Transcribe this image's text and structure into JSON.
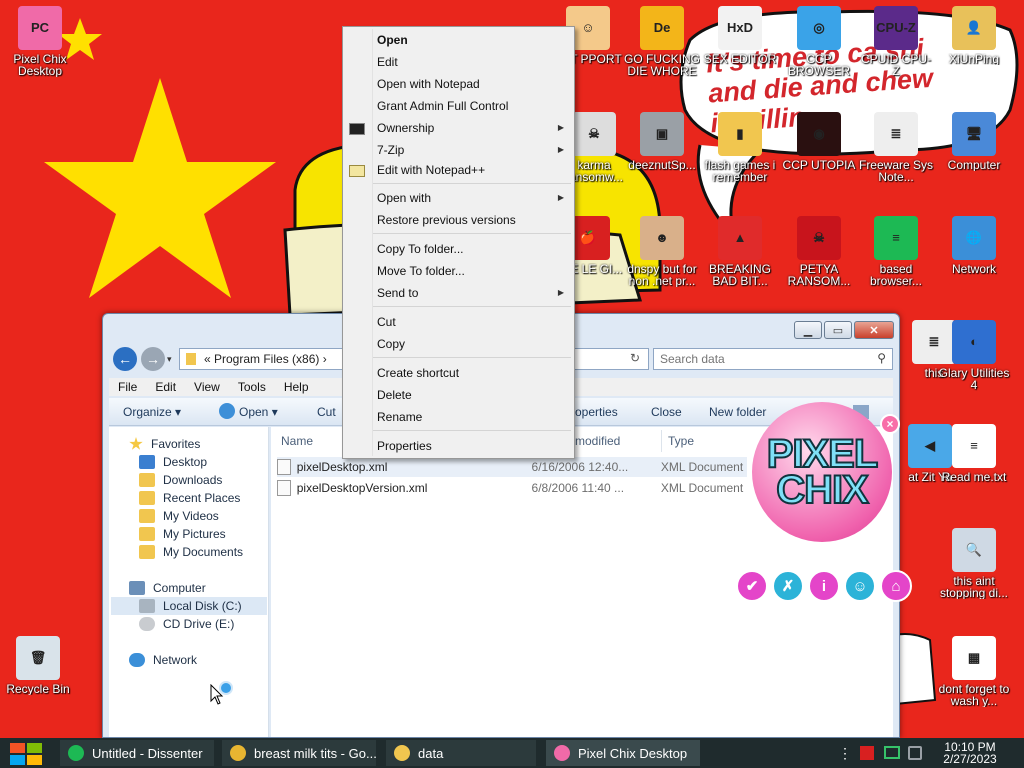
{
  "wallpaper": {
    "bubble_text": "It's time to ca shi\nand die and chew\n  ing illin",
    "colors": {
      "background": "#e9261c",
      "star": "#ffe000"
    }
  },
  "desktop_icons": [
    {
      "id": "pixel-chix",
      "label": "Pixel Chix Desktop",
      "icon": "pixel-chix-logo-icon",
      "color": "#f06aa8",
      "glyph": "PC"
    },
    {
      "id": "recycle-bin",
      "label": "Recycle Bin",
      "icon": "recycle-bin-icon",
      "color": "#d9e3ea",
      "glyph": "🗑"
    },
    {
      "id": "chat-support",
      "label": "HAT PPORT",
      "icon": "support-agent-icon",
      "color": "#f4c98a",
      "glyph": "☺"
    },
    {
      "id": "go-die",
      "label": "GO FUCKING DIE WHORE",
      "icon": "de-logo-icon",
      "color": "#f3b519",
      "glyph": "De"
    },
    {
      "id": "sex-editor",
      "label": "SEX EDITOR",
      "icon": "hxd-icon",
      "color": "#f2f2f2",
      "glyph": "HxD"
    },
    {
      "id": "ccp-browser",
      "label": "CCP BROWSER",
      "icon": "chromium-icon",
      "color": "#3aa3e8",
      "glyph": "◎"
    },
    {
      "id": "cpuid",
      "label": "CPUID CPU-Z",
      "icon": "cpuz-icon",
      "color": "#5b2a8a",
      "glyph": "CPU-Z"
    },
    {
      "id": "xiunping",
      "label": "XiUnPing",
      "icon": "user-folder-icon",
      "color": "#e8c15a",
      "glyph": "👤"
    },
    {
      "id": "karma",
      "label": "karma ransomw...",
      "icon": "skull-icon",
      "color": "#dddddd",
      "glyph": "☠"
    },
    {
      "id": "deeznut",
      "label": "deeznutSp...",
      "icon": "windows-stack-icon",
      "color": "#9aa0a6",
      "glyph": "▣"
    },
    {
      "id": "flash-games",
      "label": "flash games i remember",
      "icon": "folder-icon",
      "color": "#f1c64f",
      "glyph": "▮"
    },
    {
      "id": "ccp-utopia",
      "label": "CCP UTOPIA",
      "icon": "eye-icon",
      "color": "#2a1010",
      "glyph": "◉"
    },
    {
      "id": "freeware-notes",
      "label": "Freeware Sys Note...",
      "icon": "document-icon",
      "color": "#eeeeee",
      "glyph": "≣"
    },
    {
      "id": "computer",
      "label": "Computer",
      "icon": "computer-icon",
      "color": "#4a89d8",
      "glyph": "🖥"
    },
    {
      "id": "free-apple",
      "label": "REE LE GI...",
      "icon": "apple-icon",
      "color": "#d82020",
      "glyph": "🍎"
    },
    {
      "id": "dnspy",
      "label": "dnspy but for non .net pr...",
      "icon": "portrait-icon",
      "color": "#d9b08a",
      "glyph": "☻"
    },
    {
      "id": "breaking-bad",
      "label": "BREAKING BAD BIT...",
      "icon": "angry-bird-icon",
      "color": "#e02b2b",
      "glyph": "▲"
    },
    {
      "id": "petya",
      "label": "PETYA RANSOM...",
      "icon": "skull-crossbones-icon",
      "color": "#c8141c",
      "glyph": "☠"
    },
    {
      "id": "based-browser",
      "label": "based browser...",
      "icon": "chat-bubble-icon",
      "color": "#1db954",
      "glyph": "≡"
    },
    {
      "id": "network",
      "label": "Network",
      "icon": "globe-network-icon",
      "color": "#3b8fd8",
      "glyph": "🌐"
    },
    {
      "id": "this",
      "label": "this",
      "icon": "document-icon",
      "color": "#eeeeee",
      "glyph": "≣"
    },
    {
      "id": "glary",
      "label": "Glary Utilities 4",
      "icon": "glary-icon",
      "color": "#2f6fd0",
      "glyph": "◐"
    },
    {
      "id": "zit",
      "label": "at Zit Ya",
      "icon": "speaker-icon",
      "color": "#4aa8e8",
      "glyph": "◀"
    },
    {
      "id": "readme",
      "label": "Read me.txt",
      "icon": "text-file-icon",
      "color": "#ffffff",
      "glyph": "≡"
    },
    {
      "id": "this-aint",
      "label": "this aint stopping di...",
      "icon": "computer-search-icon",
      "color": "#cfd9e4",
      "glyph": "🔍"
    },
    {
      "id": "dont-forget",
      "label": "dont forget to wash y...",
      "icon": "calendar-icon",
      "color": "#ffffff",
      "glyph": "▦"
    }
  ],
  "explorer": {
    "address": "« Program Files (x86) ›",
    "search_placeholder": "Search data",
    "menus": [
      "File",
      "Edit",
      "View",
      "Tools",
      "Help"
    ],
    "commands": {
      "organize": "Organize ▾",
      "open": "Open ▾",
      "cut": "Cut",
      "properties": "operties",
      "close": "Close",
      "new_folder": "New folder"
    },
    "nav": {
      "favorites": "Favorites",
      "favorite_items": [
        "Desktop",
        "Downloads",
        "Recent Places",
        "My Videos",
        "My Pictures",
        "My Documents"
      ],
      "computer": "Computer",
      "computer_items": [
        "Local Disk (C:)",
        "CD Drive (E:)"
      ],
      "network": "Network"
    },
    "columns": {
      "name": "Name",
      "date": "modified",
      "type": "Type"
    },
    "files": [
      {
        "name": "pixelDesktop.xml",
        "date": "6/16/2006 12:40...",
        "type": "XML Document"
      },
      {
        "name": "pixelDesktopVersion.xml",
        "date": "6/8/2006 11:40 ...",
        "type": "XML Document"
      }
    ]
  },
  "context_menu": {
    "items": {
      "open": "Open",
      "edit": "Edit",
      "open_notepad": "Open with Notepad",
      "grant_admin": "Grant Admin Full Control",
      "ownership": "Ownership",
      "zip": "7-Zip",
      "notepadpp": "Edit with Notepad++",
      "open_with": "Open with",
      "restore": "Restore previous versions",
      "copy_to": "Copy To folder...",
      "move_to": "Move To folder...",
      "send_to": "Send to",
      "cut": "Cut",
      "copy": "Copy",
      "shortcut": "Create shortcut",
      "delete": "Delete",
      "rename": "Rename",
      "properties": "Properties"
    }
  },
  "pixel_chix_widget": {
    "logo": "PIXEL\nCHIX",
    "close": "×",
    "buttons": [
      {
        "name": "check-icon",
        "glyph": "✔",
        "color": "#e445c9"
      },
      {
        "name": "cross-icon",
        "glyph": "✗",
        "color": "#2cb3d8"
      },
      {
        "name": "info-icon",
        "glyph": "i",
        "color": "#e445c9"
      },
      {
        "name": "smiley-icon",
        "glyph": "☺",
        "color": "#2cb3d8"
      },
      {
        "name": "shop-icon",
        "glyph": "⌂",
        "color": "#e445c9"
      }
    ]
  },
  "taskbar": {
    "tasks": [
      {
        "id": "dissenter",
        "label": "Untitled - Dissenter",
        "icon": "spotify-like-icon",
        "color": "#1db954"
      },
      {
        "id": "chrome",
        "label": "breast milk tits - Go...",
        "icon": "chrome-icon",
        "color": "#e8b531"
      },
      {
        "id": "data",
        "label": "data",
        "icon": "folder-icon",
        "color": "#f1c64f"
      },
      {
        "id": "pixelchix",
        "label": "Pixel Chix Desktop",
        "icon": "pixel-chix-icon",
        "color": "#f06aa8"
      }
    ],
    "time": "10:10 PM",
    "date": "2/27/2023"
  }
}
